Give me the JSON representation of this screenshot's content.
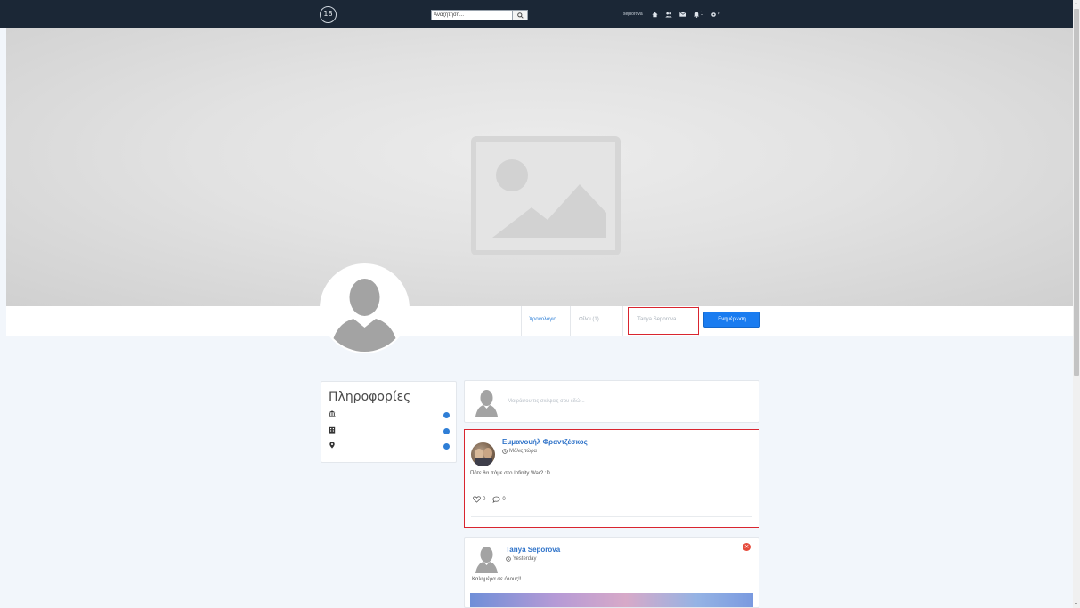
{
  "topnav": {
    "logo_text": "18",
    "search": {
      "value": "Αναζήτηση...",
      "placeholder": "Αναζήτηση..."
    },
    "username": "sepiorova",
    "notification_count": "1"
  },
  "tabs": {
    "timeline": "Χρονολόγιο",
    "friends": "Φίλοι (1)",
    "profile_name": "Tanya Seporova",
    "update_button": "Ενημέρωση"
  },
  "info": {
    "title": "Πληροφορίες"
  },
  "composer": {
    "placeholder": "Μοιράσου τις σκέψεις σου εδώ..."
  },
  "posts": [
    {
      "author": "Εμμανουήλ Φραντζέσκος",
      "time": "Μόλις τώρα",
      "text": "Πότε θα πάμε στο Infinity War? :D",
      "likes": "0",
      "comments": "0"
    },
    {
      "author": "Tanya Seporova",
      "time": "Yesterday",
      "text": "Καλημέρα σε όλους!!"
    }
  ],
  "colors": {
    "nav_bg": "#1b2736",
    "accent_blue": "#1a7cf0",
    "link_blue": "#2f73c9",
    "highlight_red": "#d9252f",
    "page_bg": "#f2f6fb"
  }
}
